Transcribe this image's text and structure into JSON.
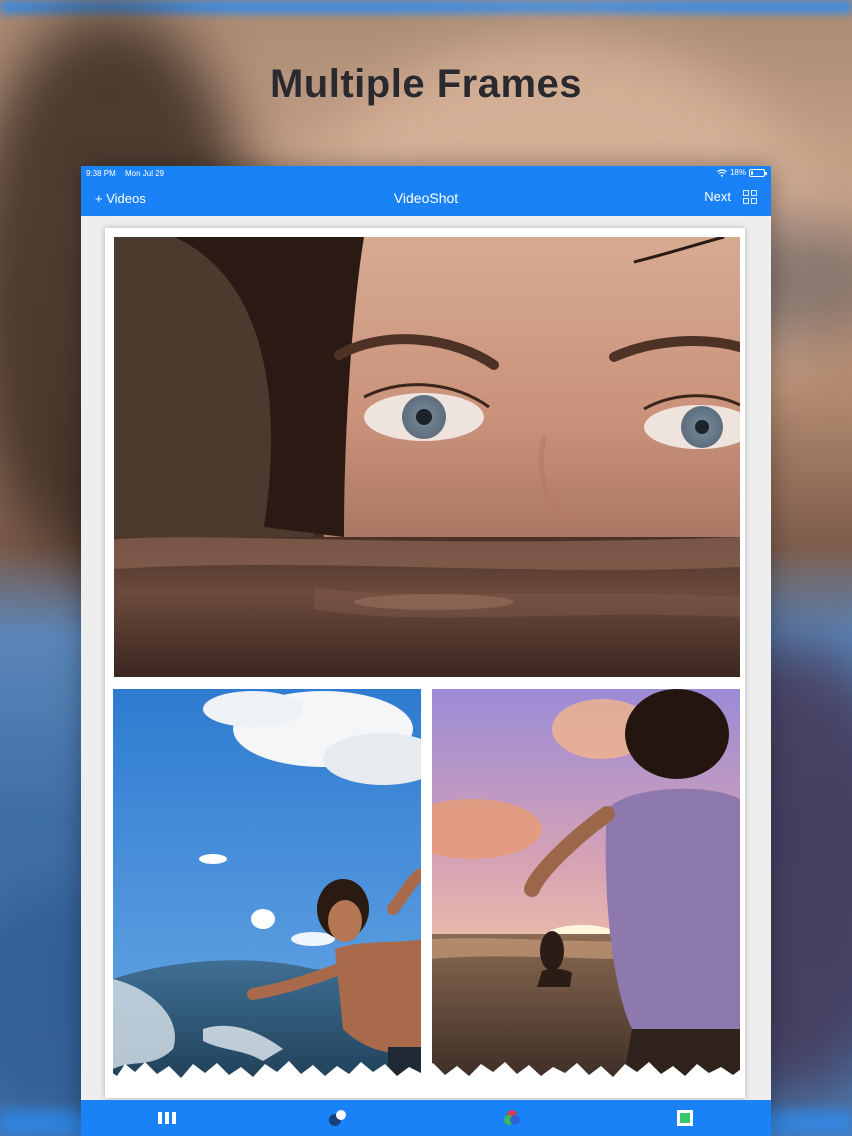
{
  "promo": {
    "title": "Multiple Frames"
  },
  "status_bar": {
    "time": "9:38 PM",
    "date": "Mon Jul 29",
    "battery_text": "18%",
    "battery_level": 0.18
  },
  "nav": {
    "back_label": "+ Videos",
    "title": "VideoShot",
    "next_label": "Next"
  },
  "collage": {
    "frames": [
      {
        "name": "frame-top",
        "subject": "face-in-water"
      },
      {
        "name": "frame-bottom-left",
        "subject": "surfer-in-waves"
      },
      {
        "name": "frame-bottom-right",
        "subject": "sunset-in-sea"
      }
    ]
  },
  "toolbar": {
    "items": [
      {
        "icon": "layout-columns-icon"
      },
      {
        "icon": "blend-circles-icon"
      },
      {
        "icon": "color-filter-icon"
      },
      {
        "icon": "frame-border-icon"
      }
    ]
  },
  "colors": {
    "accent": "#1a82f7",
    "title": "#2a2a2e"
  }
}
